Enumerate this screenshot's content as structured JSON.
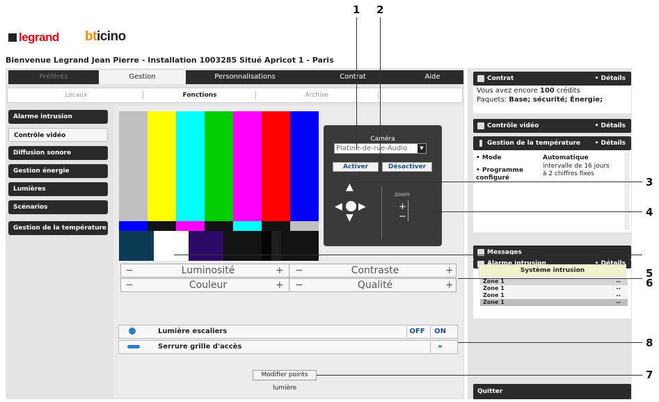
{
  "brand": {
    "legrand": "legrand",
    "bticino_a": "bt",
    "bticino_b": "icino"
  },
  "welcome": "Bienvenue Legrand Jean Pierre - Installation 1003285 Situé Apricot 1 - Paris",
  "main_tabs": [
    {
      "label": "Préférés"
    },
    {
      "label": "Gestion"
    },
    {
      "label": "Personnalisations"
    },
    {
      "label": "Contrat"
    },
    {
      "label": "Aide"
    }
  ],
  "sub_tabs": [
    {
      "label": "Locaux"
    },
    {
      "label": "Fonctions"
    },
    {
      "label": "Archive"
    }
  ],
  "side_menu": [
    {
      "label": "Alarme intrusion"
    },
    {
      "label": "Contrôle vidéo"
    },
    {
      "label": "Diffusion sonore"
    },
    {
      "label": "Gestion énergie"
    },
    {
      "label": "Lumières"
    },
    {
      "label": "Scénarios"
    },
    {
      "label": "Gestion de la température"
    }
  ],
  "camera": {
    "label": "Caméra",
    "selected": "Platine-de-rue-Audio",
    "activate": "Activer",
    "deactivate": "Désactiver",
    "zoom_label": "zoom",
    "zoom_plus": "+",
    "zoom_minus": "−"
  },
  "adjust": {
    "luminosite": "Luminosité",
    "contraste": "Contraste",
    "couleur": "Couleur",
    "qualite": "Qualité",
    "minus": "−",
    "plus": "+"
  },
  "controls": {
    "light_label": "Lumière escaliers",
    "off": "OFF",
    "on": "ON",
    "lock_label": "Serrure grille d'accès",
    "lock_btn": "»"
  },
  "modify": {
    "button": "Modifier points",
    "caption": "lumière"
  },
  "right": {
    "contrat": {
      "title": "Contrat",
      "details": "• Détails",
      "line1_a": "Vous avez encore ",
      "line1_b": "100",
      "line1_c": " crédits",
      "line2_a": "Paquets: ",
      "line2_b": "Base; sécurité; Énergie;"
    },
    "video": {
      "title": "Contrôle vidéo",
      "details": "• Détails"
    },
    "temp": {
      "title": "Gestion de la température",
      "details": "• Détails",
      "mode_k": "• Mode",
      "mode_v": "Automatique",
      "prog_k": "• Programme configuré",
      "prog_v": "intervalle de 16 jours à 2 chiffres fixes"
    },
    "messages": {
      "title": "Messages"
    },
    "alarme": {
      "title": "Alarme intrusion",
      "details": "• Détails",
      "system": "Système intrusion",
      "zones": [
        {
          "name": "Zone 1",
          "val": "--"
        },
        {
          "name": "Zone 1",
          "val": "--"
        },
        {
          "name": "Zone 1",
          "val": "--"
        },
        {
          "name": "Zone 1",
          "val": "--"
        }
      ]
    },
    "quit": "Quitter"
  },
  "callouts": [
    "1",
    "2",
    "3",
    "4",
    "5",
    "6",
    "7",
    "8"
  ]
}
